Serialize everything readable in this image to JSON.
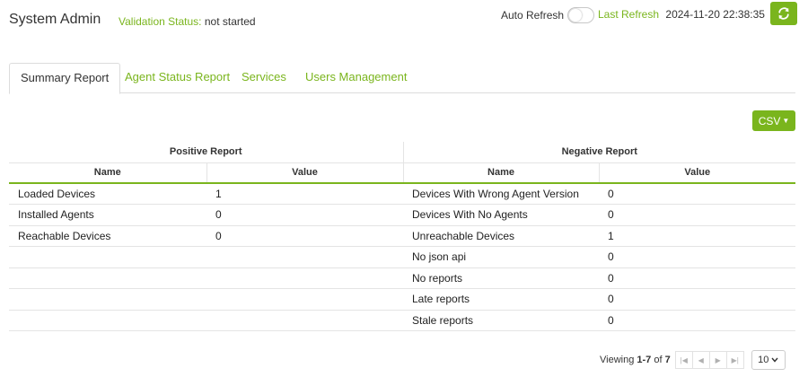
{
  "header": {
    "title": "System Admin",
    "validation_label": "Validation Status:",
    "validation_value": "not started",
    "auto_refresh_label": "Auto Refresh",
    "auto_refresh_on": false,
    "last_refresh_label": "Last Refresh",
    "last_refresh_value": "2024-11-20 22:38:35",
    "refresh_icon": "refresh-icon"
  },
  "tabs": [
    {
      "label": "Summary Report",
      "active": true
    },
    {
      "label": "Agent Status Report",
      "active": false
    },
    {
      "label": "Services",
      "active": false
    },
    {
      "label": "Users Management",
      "active": false
    }
  ],
  "toolbar": {
    "csv_label": "CSV"
  },
  "table": {
    "positive_header": "Positive Report",
    "negative_header": "Negative Report",
    "columns": {
      "name": "Name",
      "value": "Value"
    },
    "rows": [
      {
        "pos_name": "Loaded Devices",
        "pos_value": "1",
        "neg_name": "Devices With Wrong Agent Version",
        "neg_value": "0"
      },
      {
        "pos_name": "Installed Agents",
        "pos_value": "0",
        "neg_name": "Devices With No Agents",
        "neg_value": "0"
      },
      {
        "pos_name": "Reachable Devices",
        "pos_value": "0",
        "neg_name": "Unreachable Devices",
        "neg_value": "1"
      },
      {
        "pos_name": "",
        "pos_value": "",
        "neg_name": "No json api",
        "neg_value": "0"
      },
      {
        "pos_name": "",
        "pos_value": "",
        "neg_name": "No reports",
        "neg_value": "0"
      },
      {
        "pos_name": "",
        "pos_value": "",
        "neg_name": "Late reports",
        "neg_value": "0"
      },
      {
        "pos_name": "",
        "pos_value": "",
        "neg_name": "Stale reports",
        "neg_value": "0"
      }
    ]
  },
  "pagination": {
    "viewing_prefix": "Viewing",
    "range": "1-7",
    "of_label": "of",
    "total": "7",
    "page_size": "10"
  },
  "colors": {
    "accent": "#7ab51d",
    "text": "#333333",
    "border": "#e4e4e4"
  }
}
